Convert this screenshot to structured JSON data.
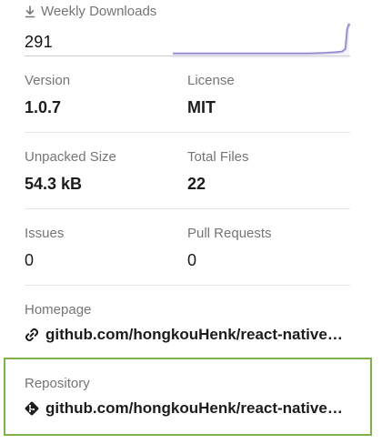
{
  "weekly_downloads": {
    "label": "Weekly Downloads",
    "value": "291",
    "icon": "download-icon",
    "sparkline_color": "#8d86c9"
  },
  "stats": {
    "version": {
      "label": "Version",
      "value": "1.0.7"
    },
    "license": {
      "label": "License",
      "value": "MIT"
    },
    "unpacked_size": {
      "label": "Unpacked Size",
      "value": "54.3 kB"
    },
    "total_files": {
      "label": "Total Files",
      "value": "22"
    },
    "issues": {
      "label": "Issues",
      "value": "0"
    },
    "pull_requests": {
      "label": "Pull Requests",
      "value": "0"
    }
  },
  "homepage": {
    "label": "Homepage",
    "link_text": "github.com/hongkouHenk/react-native-…",
    "icon": "link-icon"
  },
  "repository": {
    "label": "Repository",
    "link_text": "github.com/hongkouHenk/react-native-…",
    "icon": "git-icon",
    "highlight_color": "#7fb24a"
  },
  "colors": {
    "label_gray": "#757575",
    "text_dark": "#1c1c1c",
    "divider": "#e6e6e6"
  }
}
